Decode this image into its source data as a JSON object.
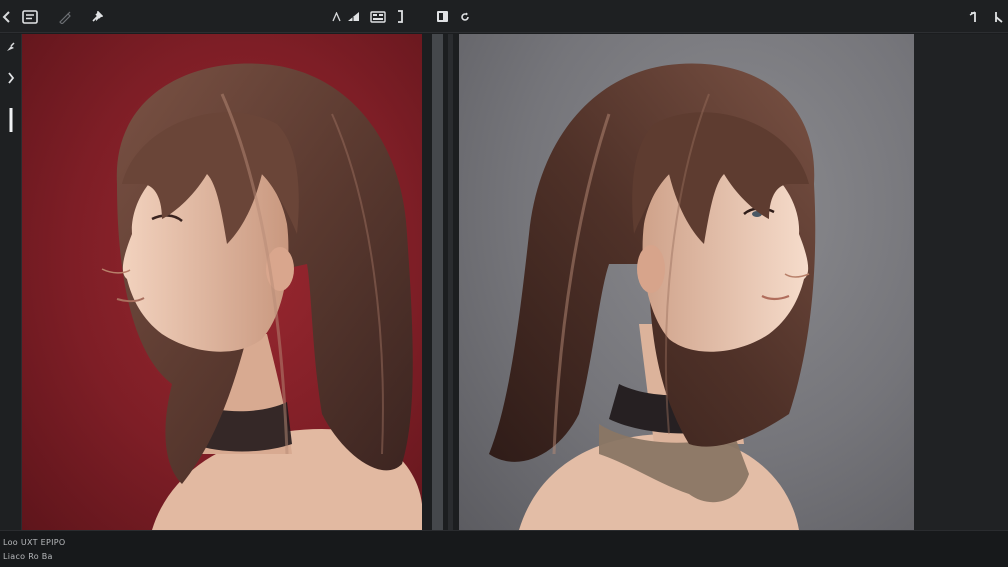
{
  "status": {
    "line1": "Loo UXT EPIPO",
    "line2": "Liaco Ro Ba"
  },
  "icons": {
    "toolbar_left": [
      "back-chevron-icon",
      "panel-icon",
      "pencil-icon",
      "pin-icon"
    ],
    "toolbar_center": [
      "text-size-icon",
      "chart-icon",
      "layout-icon",
      "bracket-icon"
    ],
    "toolbar_right_group": [
      "layers-icon",
      "refresh-icon"
    ],
    "toolbar_far_right": [
      "collapse-icon",
      "menu-icon"
    ],
    "leftbar": [
      "brush-icon",
      "expand-chevron-icon",
      "slider-handle-icon"
    ]
  },
  "colors": {
    "background": "#1b1d1f",
    "left_canvas_bg": "#7e1e26",
    "right_canvas_bg": "#75757a",
    "hair": "#5a3a2e",
    "skin": "#e7c4ae"
  }
}
